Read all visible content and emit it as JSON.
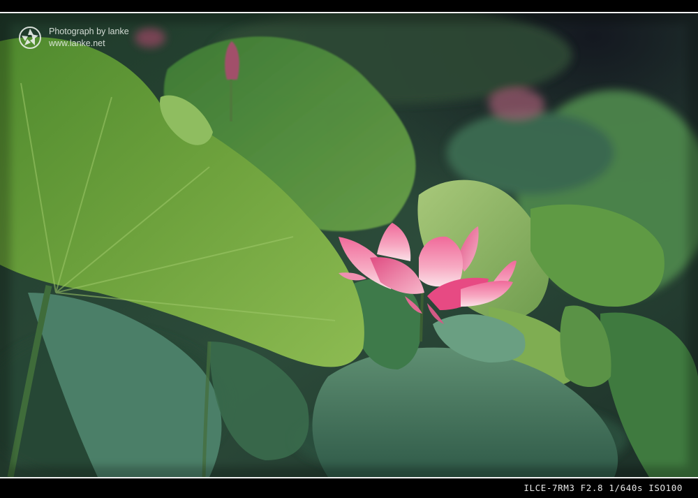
{
  "watermark": {
    "line1": "Photograph by lanke",
    "line2": "www.lanke.net",
    "logo_icon": "aperture-icon"
  },
  "exif": {
    "camera": "ILCE-7RM3",
    "aperture": "F2.8",
    "shutter": "1/640s",
    "iso": "ISO100"
  },
  "colors": {
    "frame": "#000000",
    "border_line": "#f2f2f2",
    "leaf_light": "#7fae4c",
    "leaf_dark": "#2f5a3c",
    "lotus_pink": "#f08aa8"
  }
}
